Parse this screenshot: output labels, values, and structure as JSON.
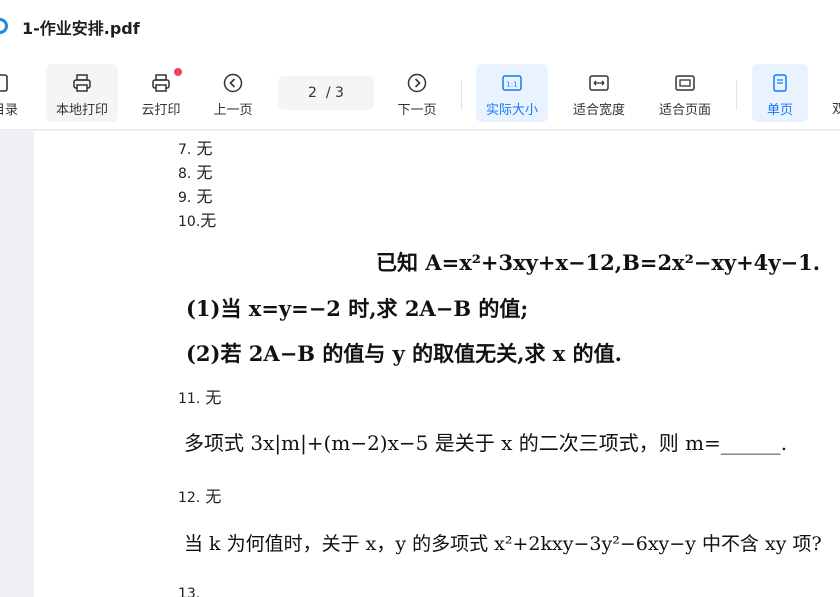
{
  "app": {
    "title": "1-作业安排.pdf"
  },
  "toolbar": {
    "items": [
      {
        "label": "目录",
        "icon": "outline-icon"
      },
      {
        "label": "本地打印",
        "icon": "printer-icon"
      },
      {
        "label": "云打印",
        "icon": "cloud-printer-icon"
      },
      {
        "label": "上一页",
        "icon": "prev-page-icon"
      },
      {
        "label": "下一页",
        "icon": "next-page-icon"
      },
      {
        "label": "实际大小",
        "icon": "actual-size-icon"
      },
      {
        "label": "适合宽度",
        "icon": "fit-width-icon"
      },
      {
        "label": "适合页面",
        "icon": "fit-page-icon"
      },
      {
        "label": "单页",
        "icon": "single-page-icon"
      }
    ],
    "page_current": "2",
    "page_total": "/ 3",
    "actual_size_glyph": "1:1",
    "active_color": "#1677ff"
  },
  "document": {
    "answers_top": [
      {
        "num": "7.",
        "text": "无"
      },
      {
        "num": "8.",
        "text": "无"
      },
      {
        "num": "9.",
        "text": "无"
      },
      {
        "num": "10.",
        "text": "无"
      }
    ],
    "problem_a": {
      "line1": "已知 A=x²+3xy+x−12,B=2x²−xy+4y−1.",
      "line2": "(1)当 x=y=−2 时,求 2A−B 的值;",
      "line3": "(2)若 2A−B 的值与 y 的取值无关,求 x 的值."
    },
    "answer_11": {
      "num": "11.",
      "text": "无"
    },
    "problem_b": "多项式 3x|m|+(m−2)x−5 是关于 x 的二次三项式，则 m=______.",
    "answer_12": {
      "num": "12.",
      "text": "无"
    },
    "problem_c": "当 k 为何值时，关于 x，y 的多项式 x²+2kxy−3y²−6xy−y 中不含 xy 项?",
    "answer_13": {
      "num": "13."
    }
  }
}
